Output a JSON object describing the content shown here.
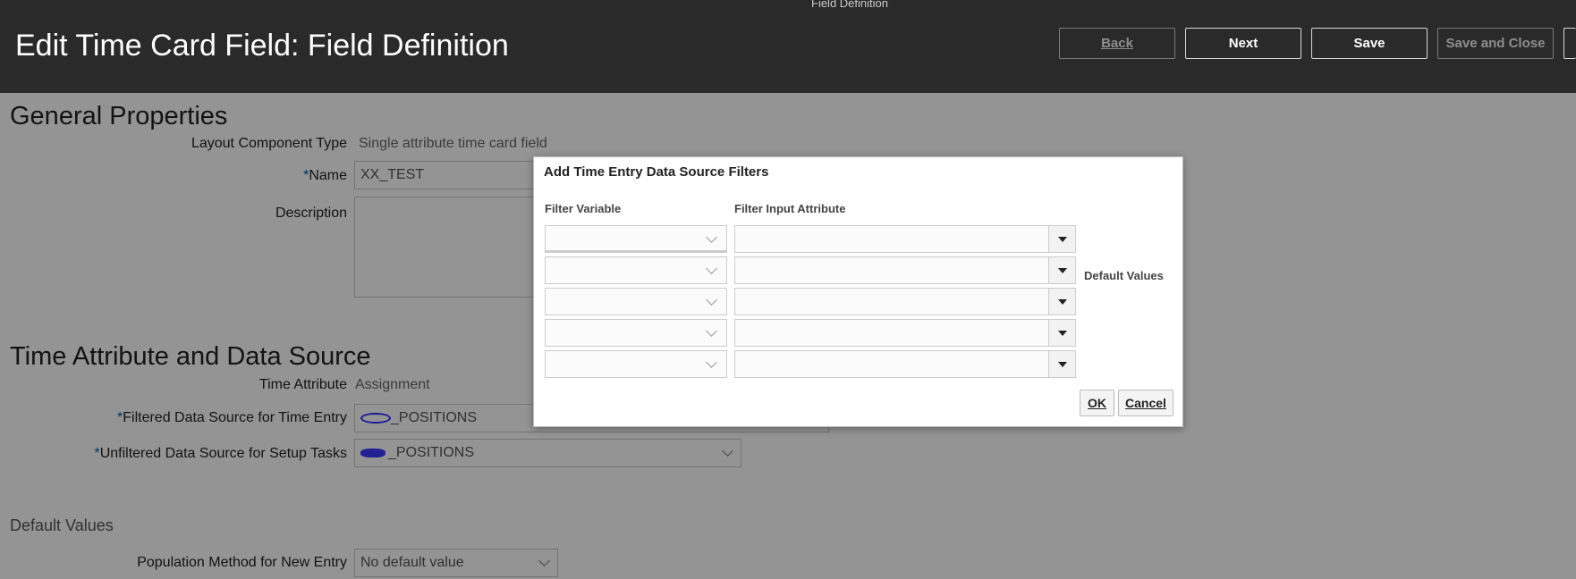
{
  "header": {
    "train_label": "Field Definition",
    "title": "Edit Time Card Field: Field Definition",
    "buttons": {
      "back": "Back",
      "next": "Next",
      "save": "Save",
      "save_close": "Save and Close"
    }
  },
  "general": {
    "section_title": "General Properties",
    "layout_component_type_label": "Layout Component Type",
    "layout_component_type_value": "Single attribute time card field",
    "name_label": "Name",
    "name_value": "XX_TEST",
    "description_label": "Description",
    "description_value": ""
  },
  "time_attr": {
    "section_title": "Time Attribute and Data Source",
    "time_attribute_label": "Time Attribute",
    "time_attribute_value": "Assignment",
    "filtered_label": "Filtered Data Source for Time Entry",
    "filtered_value": "_POSITIONS",
    "unfiltered_label": "Unfiltered Data Source for Setup Tasks",
    "unfiltered_value": "_POSITIONS"
  },
  "defaults": {
    "section_title": "Default Values",
    "population_label": "Population Method for New Entry",
    "population_value": "No default value"
  },
  "dialog": {
    "title": "Add Time Entry Data Source Filters",
    "col_filter_variable": "Filter Variable",
    "col_filter_input": "Filter Input Attribute",
    "default_values": "Default Values",
    "ok": "OK",
    "cancel": "Cancel"
  },
  "required_marker": "*",
  "colors": {
    "header_bg": "#2a2a2a",
    "required": "#005ea8"
  }
}
